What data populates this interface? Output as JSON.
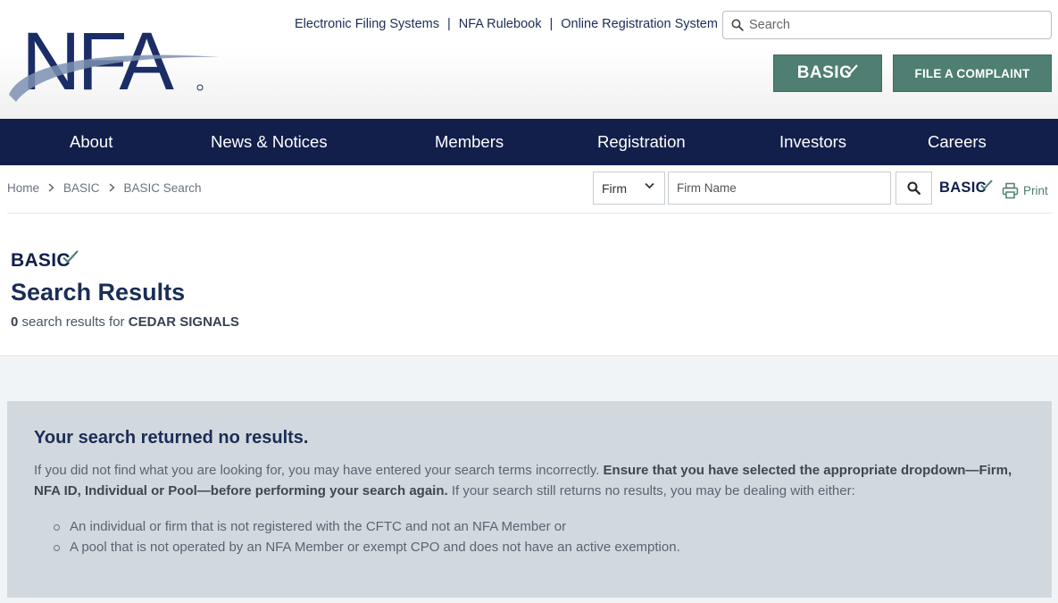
{
  "header": {
    "logo_text": "NFA",
    "top_links": [
      "Electronic Filing Systems",
      "NFA Rulebook",
      "Online Registration System"
    ],
    "top_link_separator": "|",
    "search_placeholder": "Search",
    "basic_button": "BASIC",
    "complaint_button": "FILE A COMPLAINT"
  },
  "nav": {
    "items": [
      "About",
      "News & Notices",
      "Members",
      "Registration",
      "Investors",
      "Careers"
    ]
  },
  "breadcrumb": {
    "items": [
      "Home",
      "BASIC",
      "BASIC Search"
    ]
  },
  "basic_search": {
    "type_value": "Firm",
    "firm_placeholder": "Firm Name",
    "basic_label": "BASIC",
    "print_label": "Print"
  },
  "results": {
    "basic_logo": "BASIC",
    "title": "Search Results",
    "count": "0",
    "text_mid": " search results for ",
    "query": "CEDAR SIGNALS"
  },
  "no_results": {
    "heading": "Your search returned no results.",
    "para_part1": "If you did not find what you are looking for, you may have entered your search terms incorrectly. ",
    "para_bold": "Ensure that you have selected the appropriate dropdown—Firm, NFA ID, Individual or Pool—before performing your search again.",
    "para_part2": " If your search still returns no results, you may be dealing with either:",
    "bullets": [
      "An individual or firm that is not registered with the CFTC and not an NFA Member or",
      "A pool that is not operated by an NFA Member or exempt CPO and does not have an active exemption."
    ]
  },
  "colors": {
    "navy": "#121f4b",
    "green": "#4e7f72",
    "panel": "#d2d9de"
  }
}
